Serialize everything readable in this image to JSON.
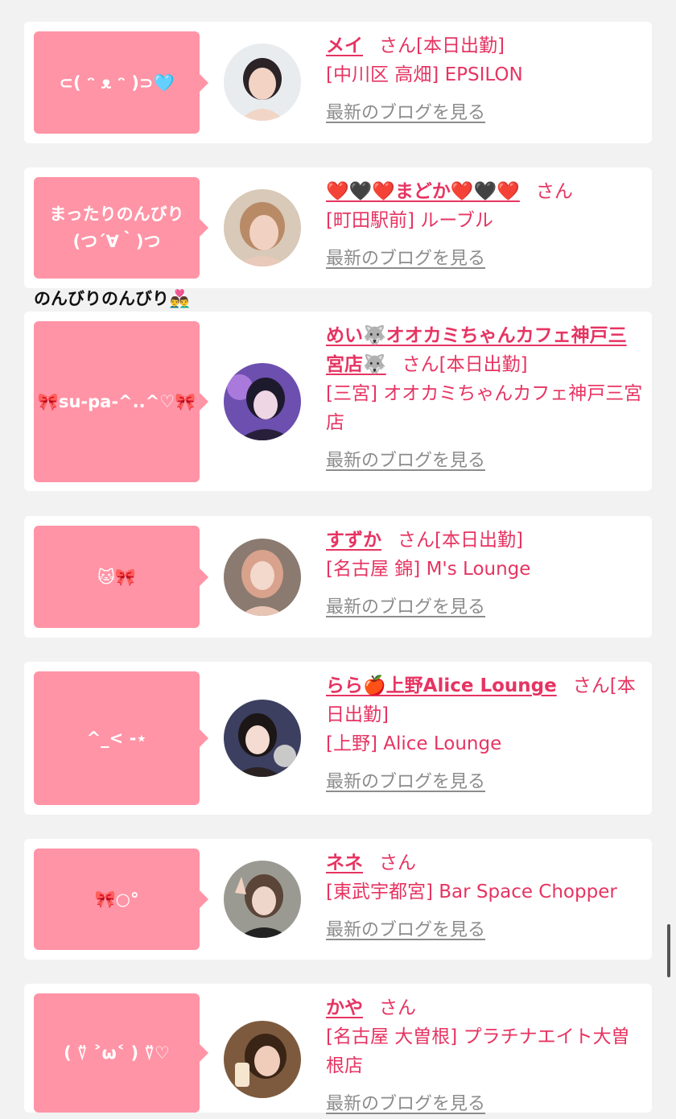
{
  "colors": {
    "background": "#f2f2f2",
    "card": "#ffffff",
    "bubble": "#ff94a6",
    "link": "#e63462",
    "muted": "#8c8c8c"
  },
  "floating_message": "のんびりのんびり👨‍❤️‍👨",
  "cards": [
    {
      "bubble_text": "⊂( ᵔ ᴥ ᵔ )⊃🩵",
      "name": "メイ",
      "san": "さん[本日出勤]",
      "shop": "[中川区 高畑] EPSILON",
      "blog_link": "最新のブログを見る",
      "avatar_icon": "profile-photo"
    },
    {
      "bubble_text": "まったりのんびり\n(つ´∀｀)つ",
      "name": "❤️🖤❤️まどか❤️🖤❤️",
      "san": "さん",
      "shop": "[町田駅前] ルーブル",
      "blog_link": "最新のブログを見る",
      "avatar_icon": "profile-photo"
    },
    {
      "bubble_text": "🎀su-pa-^..^♡🎀",
      "name": "めい🐺オオカミちゃんカフェ神戸三宮店🐺",
      "san": "さん[本日出勤]",
      "shop": "[三宮] オオカミちゃんカフェ神戸三宮店",
      "blog_link": "最新のブログを見る",
      "avatar_icon": "profile-photo"
    },
    {
      "bubble_text": "🐱🎀",
      "name": "すずか",
      "san": "さん[本日出勤]",
      "shop": "[名古屋 錦] M's Lounge",
      "blog_link": "最新のブログを見る",
      "avatar_icon": "profile-photo"
    },
    {
      "bubble_text": "^_< -⋆",
      "name": "らら🍎上野Alice Lounge",
      "san": "さん[本日出勤]",
      "shop": "[上野] Alice Lounge",
      "blog_link": "最新のブログを見る",
      "avatar_icon": "profile-photo"
    },
    {
      "bubble_text": "🎀○°",
      "name": "ネネ",
      "san": "さん",
      "shop": "[東武宇都宮] Bar Space Chopper",
      "blog_link": "最新のブログを見る",
      "avatar_icon": "profile-photo"
    },
    {
      "bubble_text": "( ⍢ ˃ω˂ ) ⍢♡",
      "name": "かや",
      "san": "さん",
      "shop": "[名古屋 大曽根] プラチナエイト大曽根店",
      "blog_link": "最新のブログを見る",
      "avatar_icon": "profile-photo"
    }
  ]
}
